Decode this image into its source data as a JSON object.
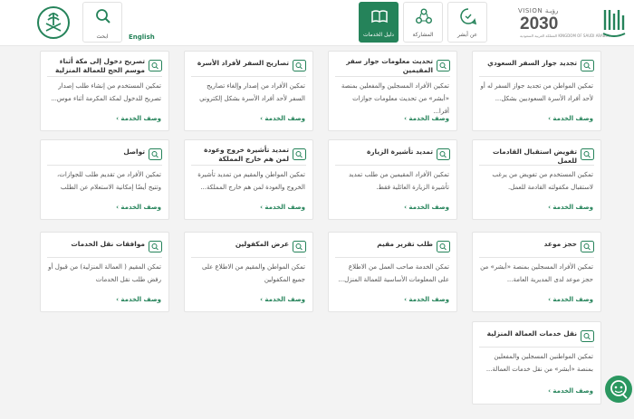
{
  "header": {
    "vision_small": "VISION رؤيـة",
    "vision_year": "2030",
    "vision_sub": "المملكة العربية السعودية KINGDOM OF SAUDI ARABIA",
    "nav": [
      {
        "label": "عن أبشر",
        "icon": "chat-circle-icon",
        "active": false
      },
      {
        "label": "المشاركة",
        "icon": "people-network-icon",
        "active": false
      },
      {
        "label": "دليل الخدمات",
        "icon": "book-icon",
        "active": true
      }
    ],
    "language": "English",
    "search_label": "ابحث",
    "colors": {
      "primary": "#25835a",
      "background": "#f3f3f3"
    }
  },
  "cards": [
    {
      "title": "تجديد جواز السفر السعودي",
      "desc": "تمكين المواطن من تجديد جواز السفر له أو لأحد أفراد الأسرة السعوديين بشكل...",
      "link": "وصف الخدمة ›"
    },
    {
      "title": "تحديث معلومات جواز سفر المقيمين",
      "desc": "تمكين الأفراد المسجلين والمفعلين بمنصة «أبشر» من تحديث معلومات جوازات أفرا...",
      "link": "وصف الخدمة ›"
    },
    {
      "title": "تصاريح السفر لأفراد الأسرة",
      "desc": "تمكين الأفراد من إصدار وإلغاء تصاريح السفر لأحد أفراد الأسرة بشكل إلكتروني",
      "link": "وصف الخدمة ›"
    },
    {
      "title": "تصريح دخول إلى مكة أثناء موسم الحج للعمالة المنزلية",
      "desc": "تمكين المستخدم من إنشاء طلب إصدار تصريح للدخول لمكة المكرمة أثناء موس...",
      "link": "وصف الخدمة ›"
    },
    {
      "title": "تفويض استقبال القادمات للعمل",
      "desc": "تمكين المستخدم من تفويض من يرغب لاستقبال مكفولته القادمة للعمل.",
      "link": "وصف الخدمة ›"
    },
    {
      "title": "تمديد تأشيرة الزيارة",
      "desc": "تمكين الأفراد المقيمين من طلب تمديد تأشيرة الزيارة العائلية فقط.",
      "link": "وصف الخدمة ›"
    },
    {
      "title": "تمديد تأشيرة خروج وعودة لمن هم خارج المملكة",
      "desc": "تمكين المواطن والمقيم من تمديد تأشيرة الخروج والعودة لمن هم خارج المملكة...",
      "link": "وصف الخدمة ›"
    },
    {
      "title": "تواصل",
      "desc": "تمكين الأفراد من تقديم طلب للجوازات، وتتيح أيضًا إمكانية الاستعلام عن الطلب",
      "link": "وصف الخدمة ›"
    },
    {
      "title": "حجز موعد",
      "desc": "تمكين الأفراد المسجلين بمنصة «أبشر» من حجز موعد لدى المديرية العامة...",
      "link": "وصف الخدمة ›"
    },
    {
      "title": "طلب تقرير مقيم",
      "desc": "تمكن الخدمة صاحب العمل من الاطلاع على المعلومات الأساسية للعمالة المنزل...",
      "link": "وصف الخدمة ›"
    },
    {
      "title": "عرض المكفولين",
      "desc": "تمكن المواطن والمقيم من الاطلاع على جميع المكفولين",
      "link": "وصف الخدمة ›"
    },
    {
      "title": "موافقات نقل الخدمات",
      "desc": "تمكن المقيم ( العمالة المنزلية) من قبول أو رفض طلب نقل الخدمات",
      "link": "وصف الخدمة ›"
    },
    {
      "title": "نقل خدمات العمالة المنزلية",
      "desc": "تمكين المواطنين المسجلين والمفعلين بمنصة «أبشر» من نقل خدمات العمالة...",
      "link": "وصف الخدمة ›"
    }
  ]
}
